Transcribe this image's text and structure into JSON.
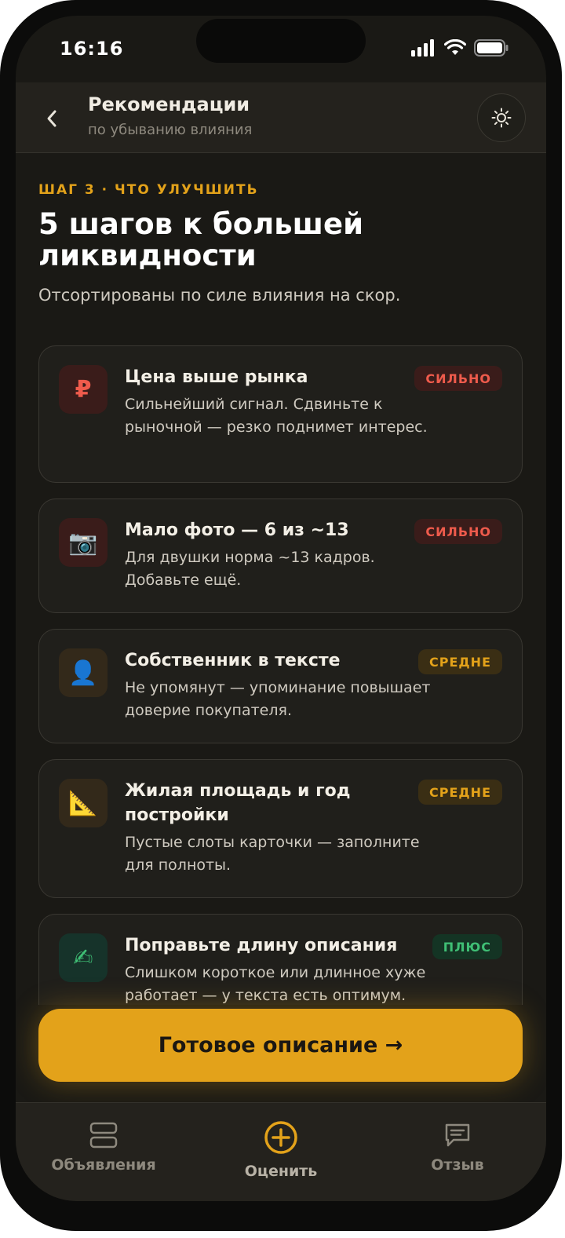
{
  "status_bar": {
    "time": "16:16"
  },
  "header": {
    "title": "Рекомендации",
    "subtitle": "по убыванию влияния"
  },
  "main": {
    "step_label": "ШАГ 3 · ЧТО УЛУЧШИТЬ",
    "headline": "5 шагов к большей ликвидности",
    "subheadline": "Отсортированы по силе влияния на скор.",
    "cards": [
      {
        "icon": "ruble-icon",
        "icon_glyph": "₽",
        "title": "Цена выше рынка",
        "text": "Сильнейший сигнал. Сдвиньте к рыночной — резко поднимет интерес.",
        "badge": "СИЛЬНО"
      },
      {
        "icon": "camera-icon",
        "icon_glyph": "📷",
        "title": "Мало фото — 6 из ~13",
        "text": "Для двушки норма ~13 кадров. Добавьте ещё.",
        "badge": "СИЛЬНО"
      },
      {
        "icon": "person-icon",
        "icon_glyph": "👤",
        "title": "Собственник в тексте",
        "text": "Не упомянут — упоминание повышает доверие покупателя.",
        "badge": "СРЕДНЕ"
      },
      {
        "icon": "triangle-ruler-icon",
        "icon_glyph": "📐",
        "title": "Жилая площадь и год постройки",
        "text": "Пустые слоты карточки — заполните для полноты.",
        "badge": "СРЕДНЕ"
      },
      {
        "icon": "writing-hand-icon",
        "icon_glyph": "✍",
        "title": "Поправьте длину описания",
        "text": "Слишком короткое или длинное хуже работает — у текста есть оптимум.",
        "badge": "ПЛЮС"
      }
    ]
  },
  "cta": {
    "label": "Готовое описание →"
  },
  "tabbar": {
    "items": [
      {
        "label": "Объявления",
        "icon": "listings-icon"
      },
      {
        "label": "Оценить",
        "icon": "add-circle-icon",
        "active": true
      },
      {
        "label": "Отзыв",
        "icon": "chat-icon"
      }
    ]
  },
  "colors": {
    "accent": "#e3a21a",
    "strong": "#ef5b4c",
    "plus": "#3fbf75",
    "background": "#1a1915"
  }
}
